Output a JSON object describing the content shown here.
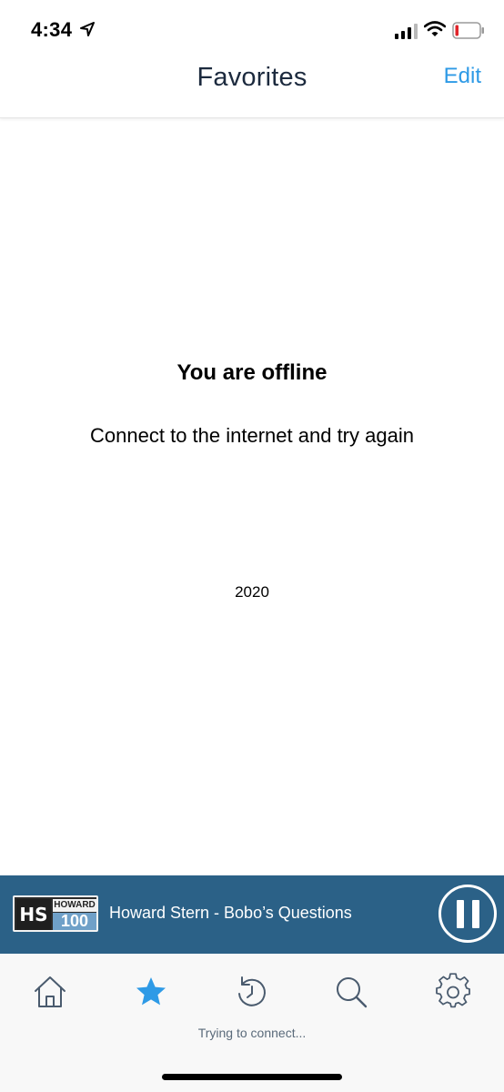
{
  "status_bar": {
    "time": "4:34",
    "icons": [
      "location-arrow-icon",
      "cell-signal-icon",
      "wifi-icon",
      "battery-low-icon"
    ]
  },
  "header": {
    "title": "Favorites",
    "edit_label": "Edit"
  },
  "main": {
    "offline_title": "You are offline",
    "offline_subtitle": "Connect to the internet and try again",
    "year": "2020"
  },
  "now_playing": {
    "logo_top": "HOWARD",
    "logo_bottom": "100",
    "logo_mark": "HS",
    "track": "Howard Stern - Bobo’s Questions",
    "control_icon": "pause-icon"
  },
  "tab_bar": {
    "tabs": [
      {
        "icon": "home-icon",
        "active": false
      },
      {
        "icon": "star-icon",
        "active": true
      },
      {
        "icon": "history-icon",
        "active": false
      },
      {
        "icon": "search-icon",
        "active": false
      },
      {
        "icon": "gear-icon",
        "active": false
      }
    ],
    "status_text": "Trying to connect..."
  },
  "colors": {
    "accent": "#2e9ae6",
    "header_text": "#1c2a3e",
    "now_playing_bg": "#2b6187",
    "tab_icon": "#4a5b6e",
    "battery_low": "#e0242a"
  }
}
